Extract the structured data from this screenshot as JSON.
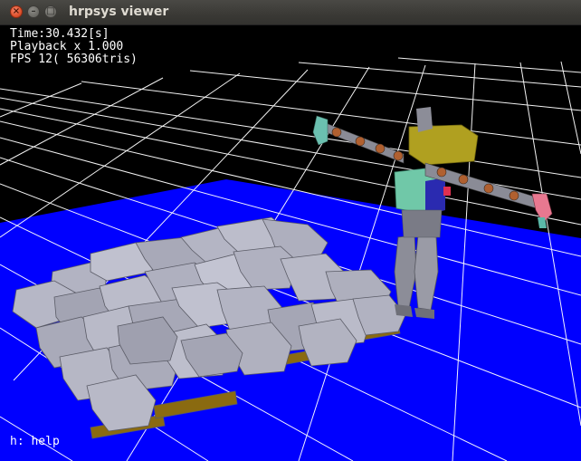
{
  "window": {
    "title": "hrpsys viewer",
    "buttons": {
      "close": "×",
      "minimize": "–",
      "maximize": "□"
    }
  },
  "hud": {
    "time": "Time:30.432[s]",
    "playback": "Playback x 1.000",
    "fps": "FPS 12( 56306tris)",
    "help": "h: help"
  },
  "colors": {
    "background": "#000000",
    "floor": "#0000ff",
    "grid": "#ffffff",
    "block": "#a9aab8",
    "block_base": "#8a6a10",
    "robot_torso": "#70c8a8",
    "robot_head": "#b0a020"
  }
}
